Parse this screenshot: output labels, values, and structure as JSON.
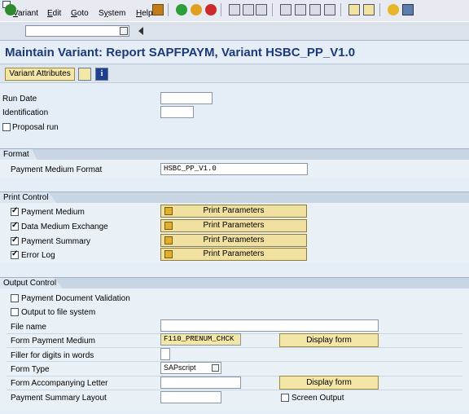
{
  "menu": [
    "Variant",
    "Edit",
    "Goto",
    "System",
    "Help"
  ],
  "menu_underline": [
    "V",
    "E",
    "G",
    "y",
    "H"
  ],
  "title": "Maintain Variant: Report SAPFPAYM, Variant HSBC_PP_V1.0",
  "appbar": {
    "variant_attributes": "Variant Attributes"
  },
  "header_fields": {
    "run_date_label": "Run Date",
    "identification_label": "Identification",
    "proposal_run_label": "Proposal run"
  },
  "format": {
    "section_title": "Format",
    "pmf_label": "Payment Medium Format",
    "pmf_value": "HSBC_PP_V1.0"
  },
  "print_control": {
    "section_title": "Print Control",
    "items": [
      {
        "label": "Payment Medium",
        "checked": true,
        "button": "Print Parameters"
      },
      {
        "label": "Data Medium Exchange",
        "checked": true,
        "button": "Print Parameters"
      },
      {
        "label": "Payment Summary",
        "checked": true,
        "button": "Print Parameters"
      },
      {
        "label": "Error Log",
        "checked": true,
        "button": "Print Parameters"
      }
    ]
  },
  "output_control": {
    "section_title": "Output Control",
    "payment_doc_validation": "Payment Document Validation",
    "output_to_file_system": "Output to file system",
    "file_name_label": "File name",
    "form_payment_medium_label": "Form Payment Medium",
    "form_payment_medium_value": "F110_PRENUM_CHCK",
    "display_form": "Display form",
    "filler_label": "Filler for digits in words",
    "form_type_label": "Form Type",
    "form_type_value": "SAPscript",
    "form_accompanying_label": "Form Accompanying Letter",
    "display_form_2": "Display form",
    "payment_summary_layout_label": "Payment Summary Layout",
    "screen_output_label": "Screen Output"
  }
}
